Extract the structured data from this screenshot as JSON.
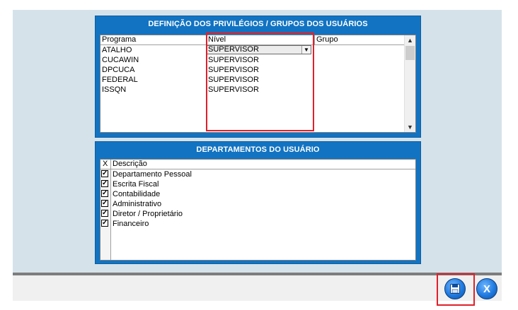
{
  "privileges_panel": {
    "title": "DEFINIÇÃO DOS PRIVILÉGIOS / GRUPOS DOS USUÁRIOS",
    "columns": [
      "Programa",
      "Nível",
      "Grupo"
    ],
    "rows": [
      {
        "programa": "ATALHO",
        "nivel": "SUPERVISOR",
        "grupo": ""
      },
      {
        "programa": "CUCAWIN",
        "nivel": "SUPERVISOR",
        "grupo": ""
      },
      {
        "programa": "DPCUCA",
        "nivel": "SUPERVISOR",
        "grupo": ""
      },
      {
        "programa": "FEDERAL",
        "nivel": "SUPERVISOR",
        "grupo": ""
      },
      {
        "programa": "ISSQN",
        "nivel": "SUPERVISOR",
        "grupo": ""
      }
    ]
  },
  "departments_panel": {
    "title": "DEPARTAMENTOS DO USUÁRIO",
    "columns": [
      "X",
      "Descrição"
    ],
    "rows": [
      {
        "checked": true,
        "descricao": "Departamento Pessoal"
      },
      {
        "checked": true,
        "descricao": "Escrita Fiscal"
      },
      {
        "checked": true,
        "descricao": "Contabilidade"
      },
      {
        "checked": true,
        "descricao": "Administrativo"
      },
      {
        "checked": true,
        "descricao": "Diretor / Proprietário"
      },
      {
        "checked": true,
        "descricao": "Financeiro"
      }
    ]
  },
  "icons": {
    "save": "save-icon",
    "close": "close-icon",
    "check_glyph": "✓",
    "scroll_up": "▲",
    "scroll_down": "▼",
    "dropdown": "▼",
    "close_glyph": "X"
  },
  "colors": {
    "panel_blue": "#1273c2",
    "highlight_red": "#e0202a",
    "workarea": "#d6e2ea"
  }
}
